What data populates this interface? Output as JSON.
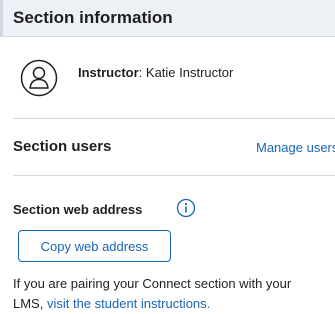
{
  "header": {
    "title": "Section information"
  },
  "instructor": {
    "label": "Instructor",
    "separator": ": ",
    "name": "Katie Instructor"
  },
  "section_users": {
    "heading": "Section users",
    "manage_link": "Manage users"
  },
  "web_address": {
    "heading": "Section web address",
    "info_icon": "info-icon",
    "copy_button": "Copy web address"
  },
  "pairing": {
    "line1": "If you are pairing your Connect section with your",
    "line2_prefix": "LMS,",
    "link_text": "visit the student instructions."
  },
  "colors": {
    "accent": "#1a63b8",
    "header_bg": "#edf1f6",
    "text": "#1f1f1f"
  }
}
